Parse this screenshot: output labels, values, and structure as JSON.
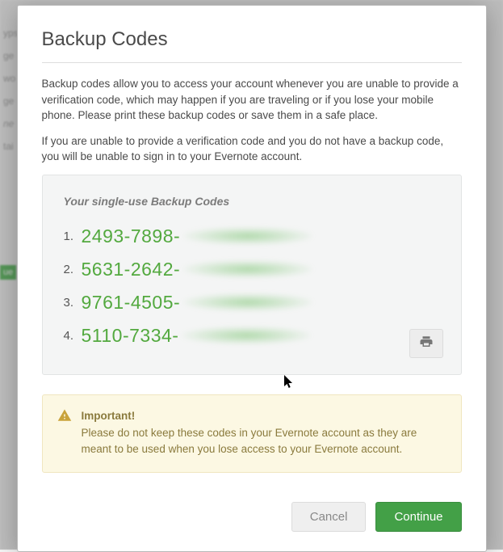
{
  "modal": {
    "title": "Backup Codes",
    "paragraph1": "Backup codes allow you to access your account whenever you are unable to provide a verification code, which may happen if you are traveling or if you lose your mobile phone. Please print these backup codes or save them in a safe place.",
    "paragraph2": "If you are unable to provide a verification code and you do not have a backup code, you will be unable to sign in to your Evernote account.",
    "codes_heading": "Your single-use Backup Codes",
    "codes": [
      {
        "index": "1.",
        "visible": "2493-7898-"
      },
      {
        "index": "2.",
        "visible": "5631-2642-"
      },
      {
        "index": "3.",
        "visible": "9761-4505-"
      },
      {
        "index": "4.",
        "visible": "5110-7334-"
      }
    ],
    "alert": {
      "title": "Important!",
      "text": "Please do not keep these codes in your Evernote account as they are meant to be used when you lose access to your Evernote account."
    },
    "buttons": {
      "cancel": "Cancel",
      "continue": "Continue"
    }
  },
  "background": {
    "frag1": "yps",
    "frag2": "ge",
    "frag3": "wo",
    "frag4": "ge",
    "frag5": "ne",
    "frag6": "tai",
    "tag": "ue"
  }
}
